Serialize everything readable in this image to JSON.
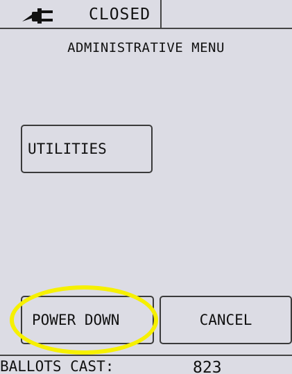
{
  "status_bar": {
    "status": "CLOSED",
    "icon": "power-plug-icon"
  },
  "menu": {
    "title": "ADMINISTRATIVE MENU"
  },
  "buttons": {
    "utilities": "UTILITIES",
    "power_down": "POWER DOWN",
    "cancel": "CANCEL"
  },
  "footer": {
    "label": "BALLOTS CAST:",
    "value": "823"
  },
  "colors": {
    "background": "#dcdce4",
    "highlight": "#f6f000",
    "border": "#3a3a3a"
  }
}
